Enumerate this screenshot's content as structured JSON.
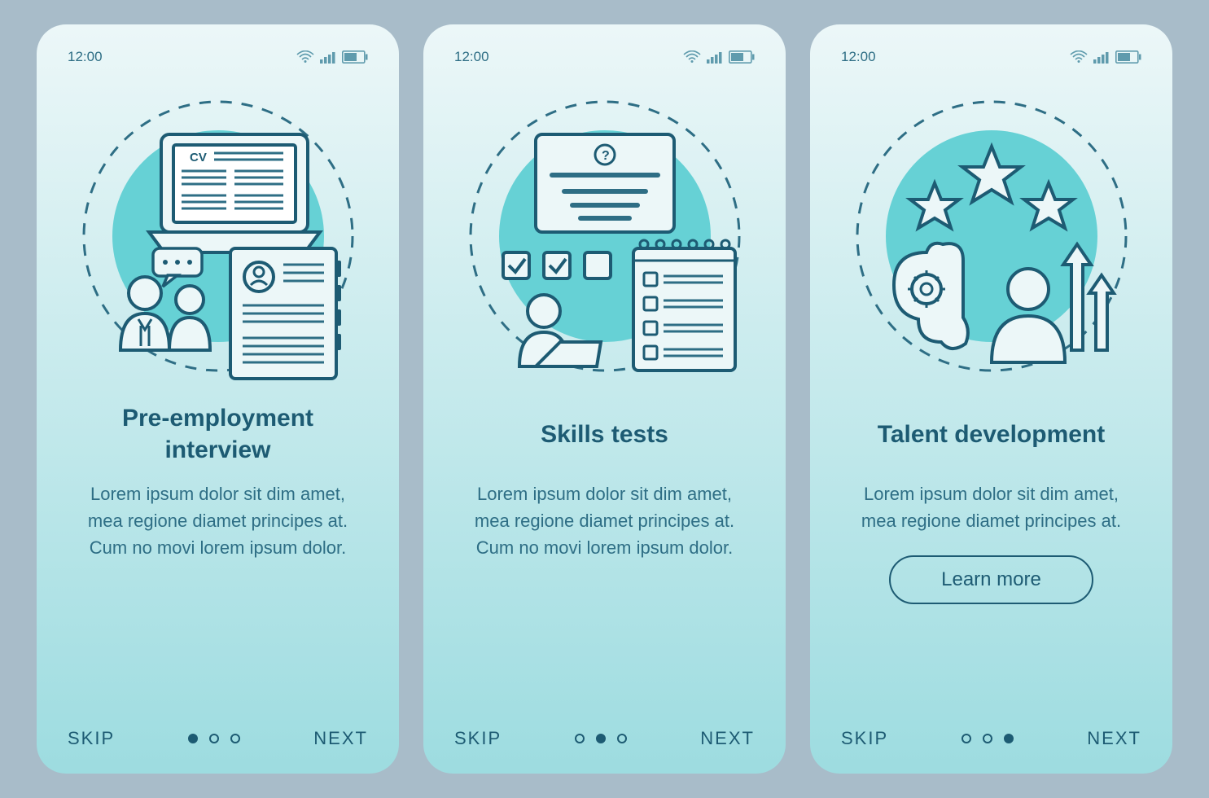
{
  "status": {
    "time": "12:00"
  },
  "screens": [
    {
      "title": "Pre-employment interview",
      "body": "Lorem ipsum dolor sit dim amet, mea regione diamet principes at. Cum no movi lorem ipsum dolor.",
      "cta": null,
      "active_dot": 0
    },
    {
      "title": "Skills tests",
      "body": "Lorem ipsum dolor sit dim amet, mea regione diamet principes at. Cum no movi lorem ipsum dolor.",
      "cta": null,
      "active_dot": 1
    },
    {
      "title": "Talent development",
      "body": "Lorem ipsum dolor sit dim amet, mea regione diamet principes at.",
      "cta": "Learn more",
      "active_dot": 2
    }
  ],
  "nav": {
    "skip": "SKIP",
    "next": "NEXT"
  },
  "colors": {
    "stroke": "#1d5b73",
    "accent_fill": "#66d1d5",
    "accent_stroke": "#2e6e85"
  }
}
